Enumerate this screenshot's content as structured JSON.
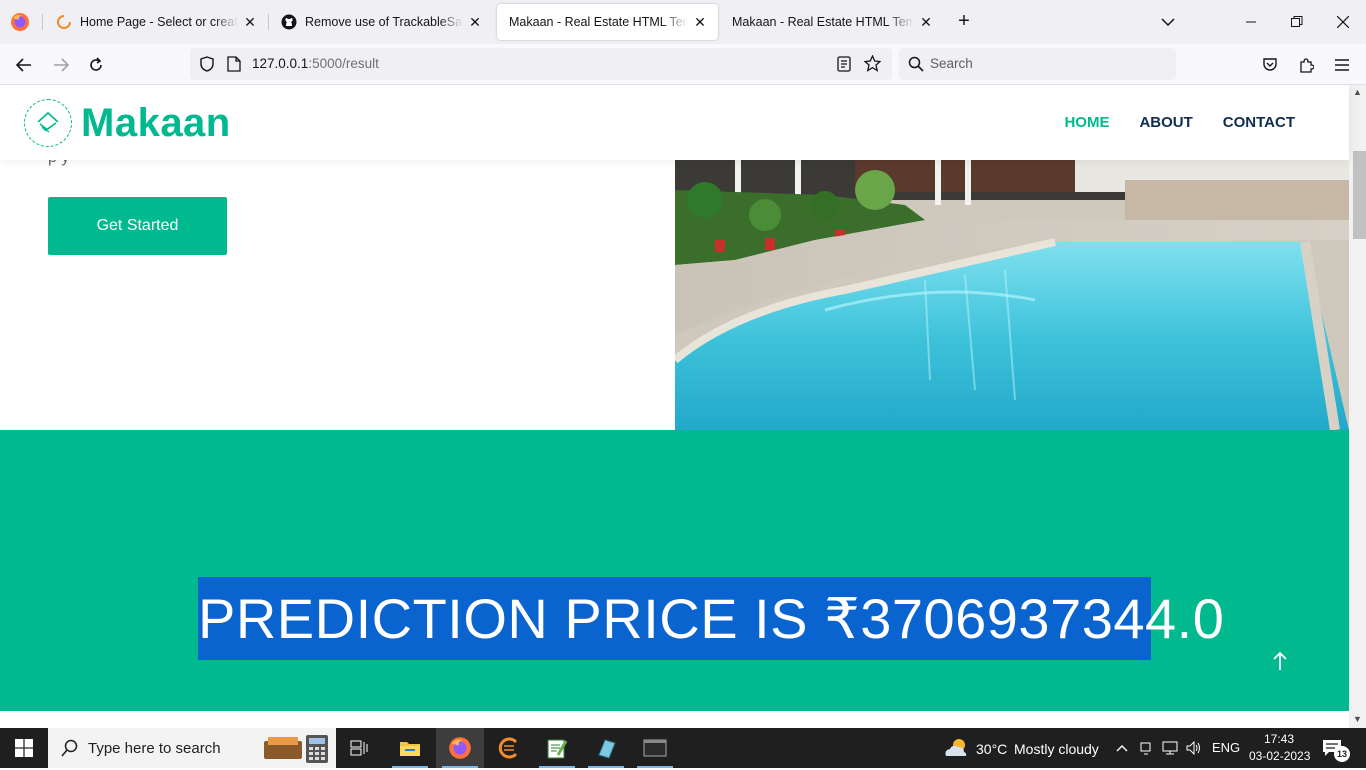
{
  "browser": {
    "tabs": [
      {
        "title": "Home Page - Select or create a",
        "icon": "spinner-icon",
        "active": false
      },
      {
        "title": "Remove use of TrackableSaver in",
        "icon": "github-icon",
        "active": false
      },
      {
        "title": "Makaan - Real Estate HTML Template",
        "icon": "none",
        "active": true
      },
      {
        "title": "Makaan - Real Estate HTML Template",
        "icon": "none",
        "active": false
      }
    ],
    "url_host": "127.0.0.1",
    "url_path": ":5000/result",
    "search_placeholder": "Search"
  },
  "site": {
    "brand": "Makaan",
    "nav": [
      {
        "label": "HOME",
        "active": true
      },
      {
        "label": "ABOUT",
        "active": false
      },
      {
        "label": "CONTACT",
        "active": false
      }
    ],
    "hero_partial_text": "p               y",
    "cta_label": "Get Started",
    "prediction_text": "PREDICTION PRICE IS ₹3706937344.0",
    "accent_color": "#00b98e",
    "heading_color": "#0e2e50",
    "selection_color": "#0a64d0"
  },
  "taskbar": {
    "search_placeholder": "Type here to search",
    "weather_temp": "30°C",
    "weather_desc": "Mostly cloudy",
    "language": "ENG",
    "time": "17:43",
    "date": "03-02-2023",
    "notification_count": "13"
  }
}
